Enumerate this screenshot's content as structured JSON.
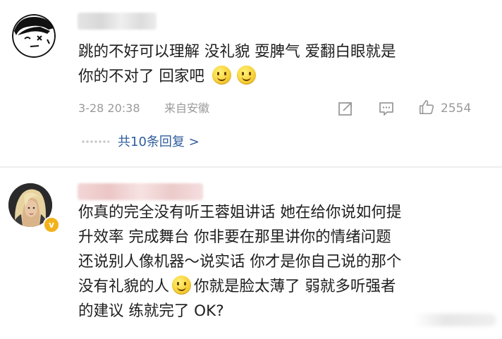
{
  "comments": [
    {
      "body_lines": [
        "跳的不好可以理解  没礼貌  耍脾气  爱翻白眼就是",
        "你的不对了  回家吧"
      ],
      "date": "3-28 20:38",
      "source": "来自安徽",
      "like_count": "2554",
      "replies_text": "共10条回复 >"
    },
    {
      "body_lines": [
        "你真的完全没有听王蓉姐讲话  她在给你说如何提",
        "升效率  完成舞台  你非要在那里讲你的情绪问题",
        "还说别人像机器～说实话  你才是你自己说的那个",
        "没有礼貌的人",
        "你就是脸太薄了  弱就多听强者",
        "的建议  练就完了  OK?"
      ]
    }
  ],
  "icons": {
    "avatar_1": "cartoon-face-avatar",
    "avatar_2": "blonde-character-avatar",
    "emoji": "smiley-emoji",
    "share": "share-icon",
    "comment": "comment-icon",
    "like": "thumbs-up-icon"
  },
  "colors": {
    "link": "#2f5d9c",
    "meta": "#9a9a9a",
    "badge": "#f2b21a"
  }
}
